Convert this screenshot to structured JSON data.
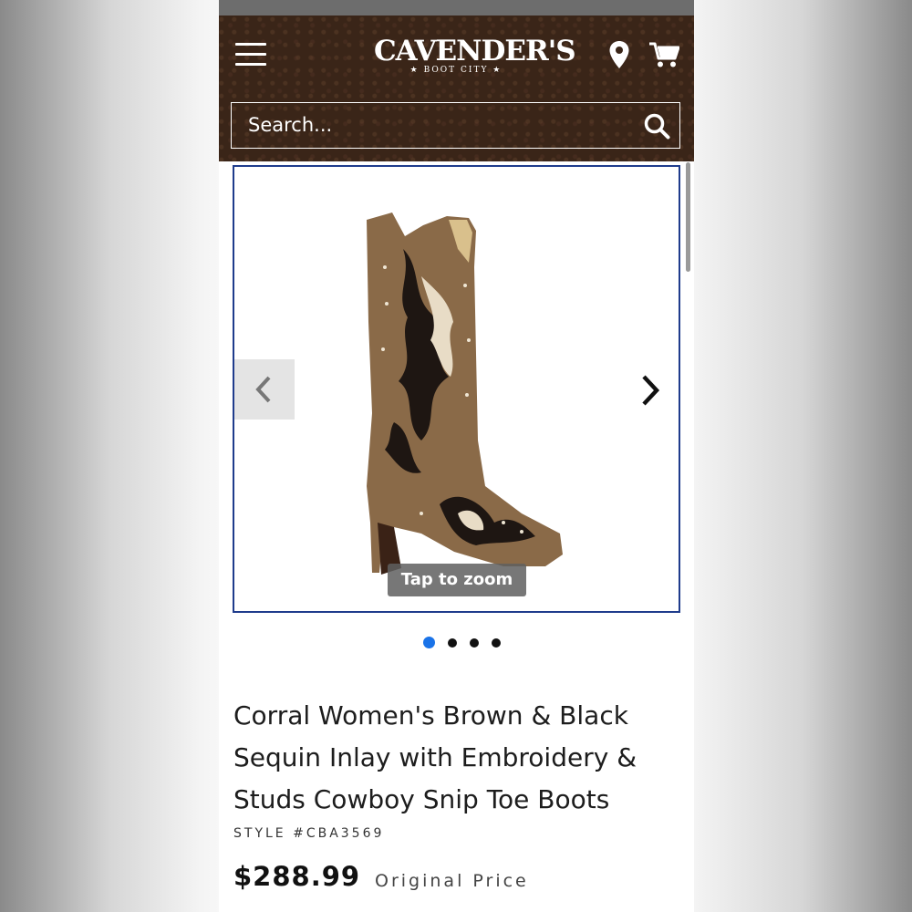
{
  "header": {
    "logo_main": "CAVENDER'S",
    "logo_sub": "★ BOOT CITY ★",
    "brand_color": "#3a2518"
  },
  "search": {
    "placeholder": "Search..."
  },
  "gallery": {
    "zoom_hint": "Tap to zoom",
    "slide_count": 4,
    "active_slide": 1,
    "border_color": "#1f3c8c",
    "active_dot_color": "#1a73e8"
  },
  "product": {
    "title": "Corral Women's Brown & Black Sequin Inlay with Embroidery & Studs Cowboy Snip Toe Boots",
    "style_number": "STYLE #CBA3569",
    "price": "$288.99",
    "price_note": "Original Price"
  },
  "icons": {
    "menu": "hamburger-icon",
    "location": "map-pin-icon",
    "cart": "shopping-cart-icon",
    "search": "search-icon",
    "prev": "chevron-left-icon",
    "next": "chevron-right-icon"
  }
}
